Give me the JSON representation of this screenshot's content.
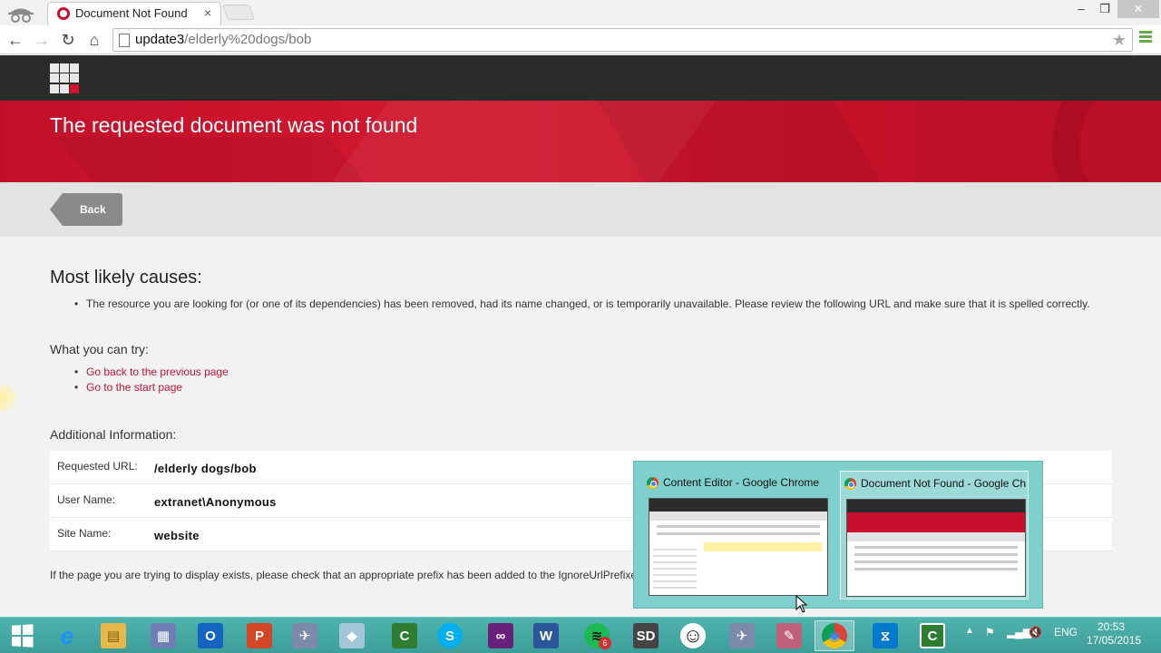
{
  "browser": {
    "tab_title": "Document Not Found",
    "tab_close": "×",
    "window_controls": {
      "minimize": "–",
      "maximize": "❐",
      "close": "✕"
    },
    "nav": {
      "back": "←",
      "forward": "→",
      "reload": "↻",
      "home": "⌂"
    },
    "address": {
      "host": "update3",
      "path": "/elderly%20dogs/bob"
    },
    "bookmark_star": "★"
  },
  "page": {
    "banner_title": "The requested document was not found",
    "back_label": "Back",
    "causes_heading": "Most likely causes:",
    "causes": [
      "The resource you are looking for (or one of its dependencies) has been removed, had its name changed, or is temporarily unavailable. Please review the following URL and make sure that it is spelled correctly."
    ],
    "try_heading": "What you can try:",
    "try_links": [
      "Go back to the previous page",
      "Go to the start page"
    ],
    "info_heading": "Additional Information:",
    "info_rows": [
      {
        "label": "Requested URL:",
        "value": "/elderly dogs/bob"
      },
      {
        "label": "User Name:",
        "value": "extranet\\Anonymous"
      },
      {
        "label": "Site Name:",
        "value": "website"
      }
    ],
    "footnote": "If the page you are trying to display exists, please check that an appropriate prefix has been added to the IgnoreUrlPrefixes"
  },
  "thumbnails": [
    {
      "title": "Content Editor - Google Chrome"
    },
    {
      "title": "Document Not Found - Google Chrome"
    }
  ],
  "taskbar": {
    "apps": [
      {
        "name": "start",
        "glyph": ""
      },
      {
        "name": "internet-explorer",
        "glyph": "e",
        "color": "#1e90ff"
      },
      {
        "name": "file-explorer",
        "glyph": "▤",
        "color": "#e8b84a"
      },
      {
        "name": "server-tool",
        "glyph": "▦",
        "color": "#6f7fb5"
      },
      {
        "name": "outlook",
        "glyph": "O",
        "color": "#1565c0"
      },
      {
        "name": "powerpoint",
        "glyph": "P",
        "color": "#d24726"
      },
      {
        "name": "satellite-tool",
        "glyph": "✈",
        "color": "#7a8aa8"
      },
      {
        "name": "notes-tool",
        "glyph": "◆",
        "color": "#9fc7d8"
      },
      {
        "name": "camtasia",
        "glyph": "C",
        "color": "#2e7d32"
      },
      {
        "name": "skype",
        "glyph": "S",
        "color": "#00aff0"
      },
      {
        "name": "visual-studio",
        "glyph": "∞",
        "color": "#68217a"
      },
      {
        "name": "word",
        "glyph": "W",
        "color": "#2b579a"
      },
      {
        "name": "spotify",
        "glyph": "≋",
        "color": "#1db954"
      },
      {
        "name": "sd-tool",
        "glyph": "SD",
        "color": "#444444"
      },
      {
        "name": "smiley-tool",
        "glyph": "☺",
        "color": "#ffffff"
      },
      {
        "name": "satellite-tool-2",
        "glyph": "✈",
        "color": "#7a8aa8"
      },
      {
        "name": "paint-tool",
        "glyph": "✎",
        "color": "#c0607a"
      },
      {
        "name": "chrome",
        "glyph": "◉",
        "color": "#db4437"
      },
      {
        "name": "vscode",
        "glyph": "⧖",
        "color": "#007acc"
      },
      {
        "name": "camtasia-2",
        "glyph": "C",
        "color": "#2e7d32"
      }
    ],
    "spotify_badge": "6",
    "tray_lang": "ENG",
    "clock_time": "20:53",
    "clock_date": "17/05/2015"
  }
}
